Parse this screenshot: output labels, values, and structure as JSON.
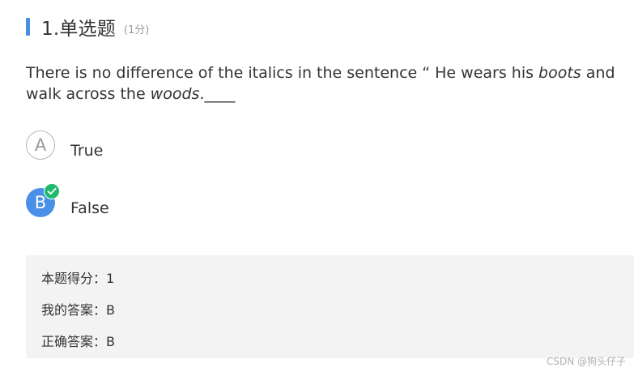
{
  "question": {
    "title": "1.单选题",
    "score": "(1分)",
    "stem_part1": "There is no difference of the italics in the sentence  “ He wears his ",
    "stem_italic1": "boots",
    "stem_part2": " and walk across the ",
    "stem_italic2": "woods",
    "stem_part3": ".____"
  },
  "options": [
    {
      "letter": "A",
      "label": "True",
      "selected": false
    },
    {
      "letter": "B",
      "label": "False",
      "selected": true
    }
  ],
  "result": {
    "score_line": "本题得分：1",
    "my_answer_line": "我的答案：B",
    "correct_answer_line": "正确答案：B"
  },
  "watermark": "CSDN @狗头仔子",
  "icons": {
    "header_bar": "section-bar",
    "check": "check-icon"
  },
  "colors": {
    "accent": "#4a90e2",
    "selected": "#4a8fe8",
    "correct": "#1fba6b",
    "panel_bg": "#f3f3f3"
  }
}
